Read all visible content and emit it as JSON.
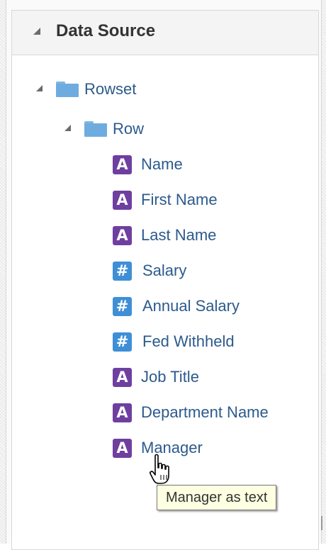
{
  "panel": {
    "title": "Data Source",
    "toggle_icon": "collapse-triangle-icon"
  },
  "tree": {
    "root": {
      "label": "Rowset",
      "icon": "folder-icon",
      "expanded": true
    },
    "group": {
      "label": "Row",
      "icon": "folder-icon",
      "expanded": true
    },
    "fields": [
      {
        "label": "Name",
        "type": "text",
        "icon": "text-type-icon",
        "glyph": "A"
      },
      {
        "label": "First Name",
        "type": "text",
        "icon": "text-type-icon",
        "glyph": "A"
      },
      {
        "label": "Last Name",
        "type": "text",
        "icon": "text-type-icon",
        "glyph": "A"
      },
      {
        "label": "Salary",
        "type": "number",
        "icon": "number-type-icon",
        "glyph": "#"
      },
      {
        "label": "Annual Salary",
        "type": "number",
        "icon": "number-type-icon",
        "glyph": "#"
      },
      {
        "label": "Fed Withheld",
        "type": "number",
        "icon": "number-type-icon",
        "glyph": "#"
      },
      {
        "label": "Job Title",
        "type": "text",
        "icon": "text-type-icon",
        "glyph": "A"
      },
      {
        "label": "Department Name",
        "type": "text",
        "icon": "text-type-icon",
        "glyph": "A"
      },
      {
        "label": "Manager",
        "type": "text",
        "icon": "text-type-icon",
        "glyph": "A"
      }
    ]
  },
  "tooltip": {
    "text": "Manager as text"
  },
  "cursor": {
    "icon": "hand-pointer-cursor-icon"
  },
  "colors": {
    "text_type": "#6f3fa0",
    "number_type": "#3f8fd6",
    "folder": "#6eace0",
    "label": "#2c5a8c",
    "tooltip_bg": "#ffffe1"
  }
}
